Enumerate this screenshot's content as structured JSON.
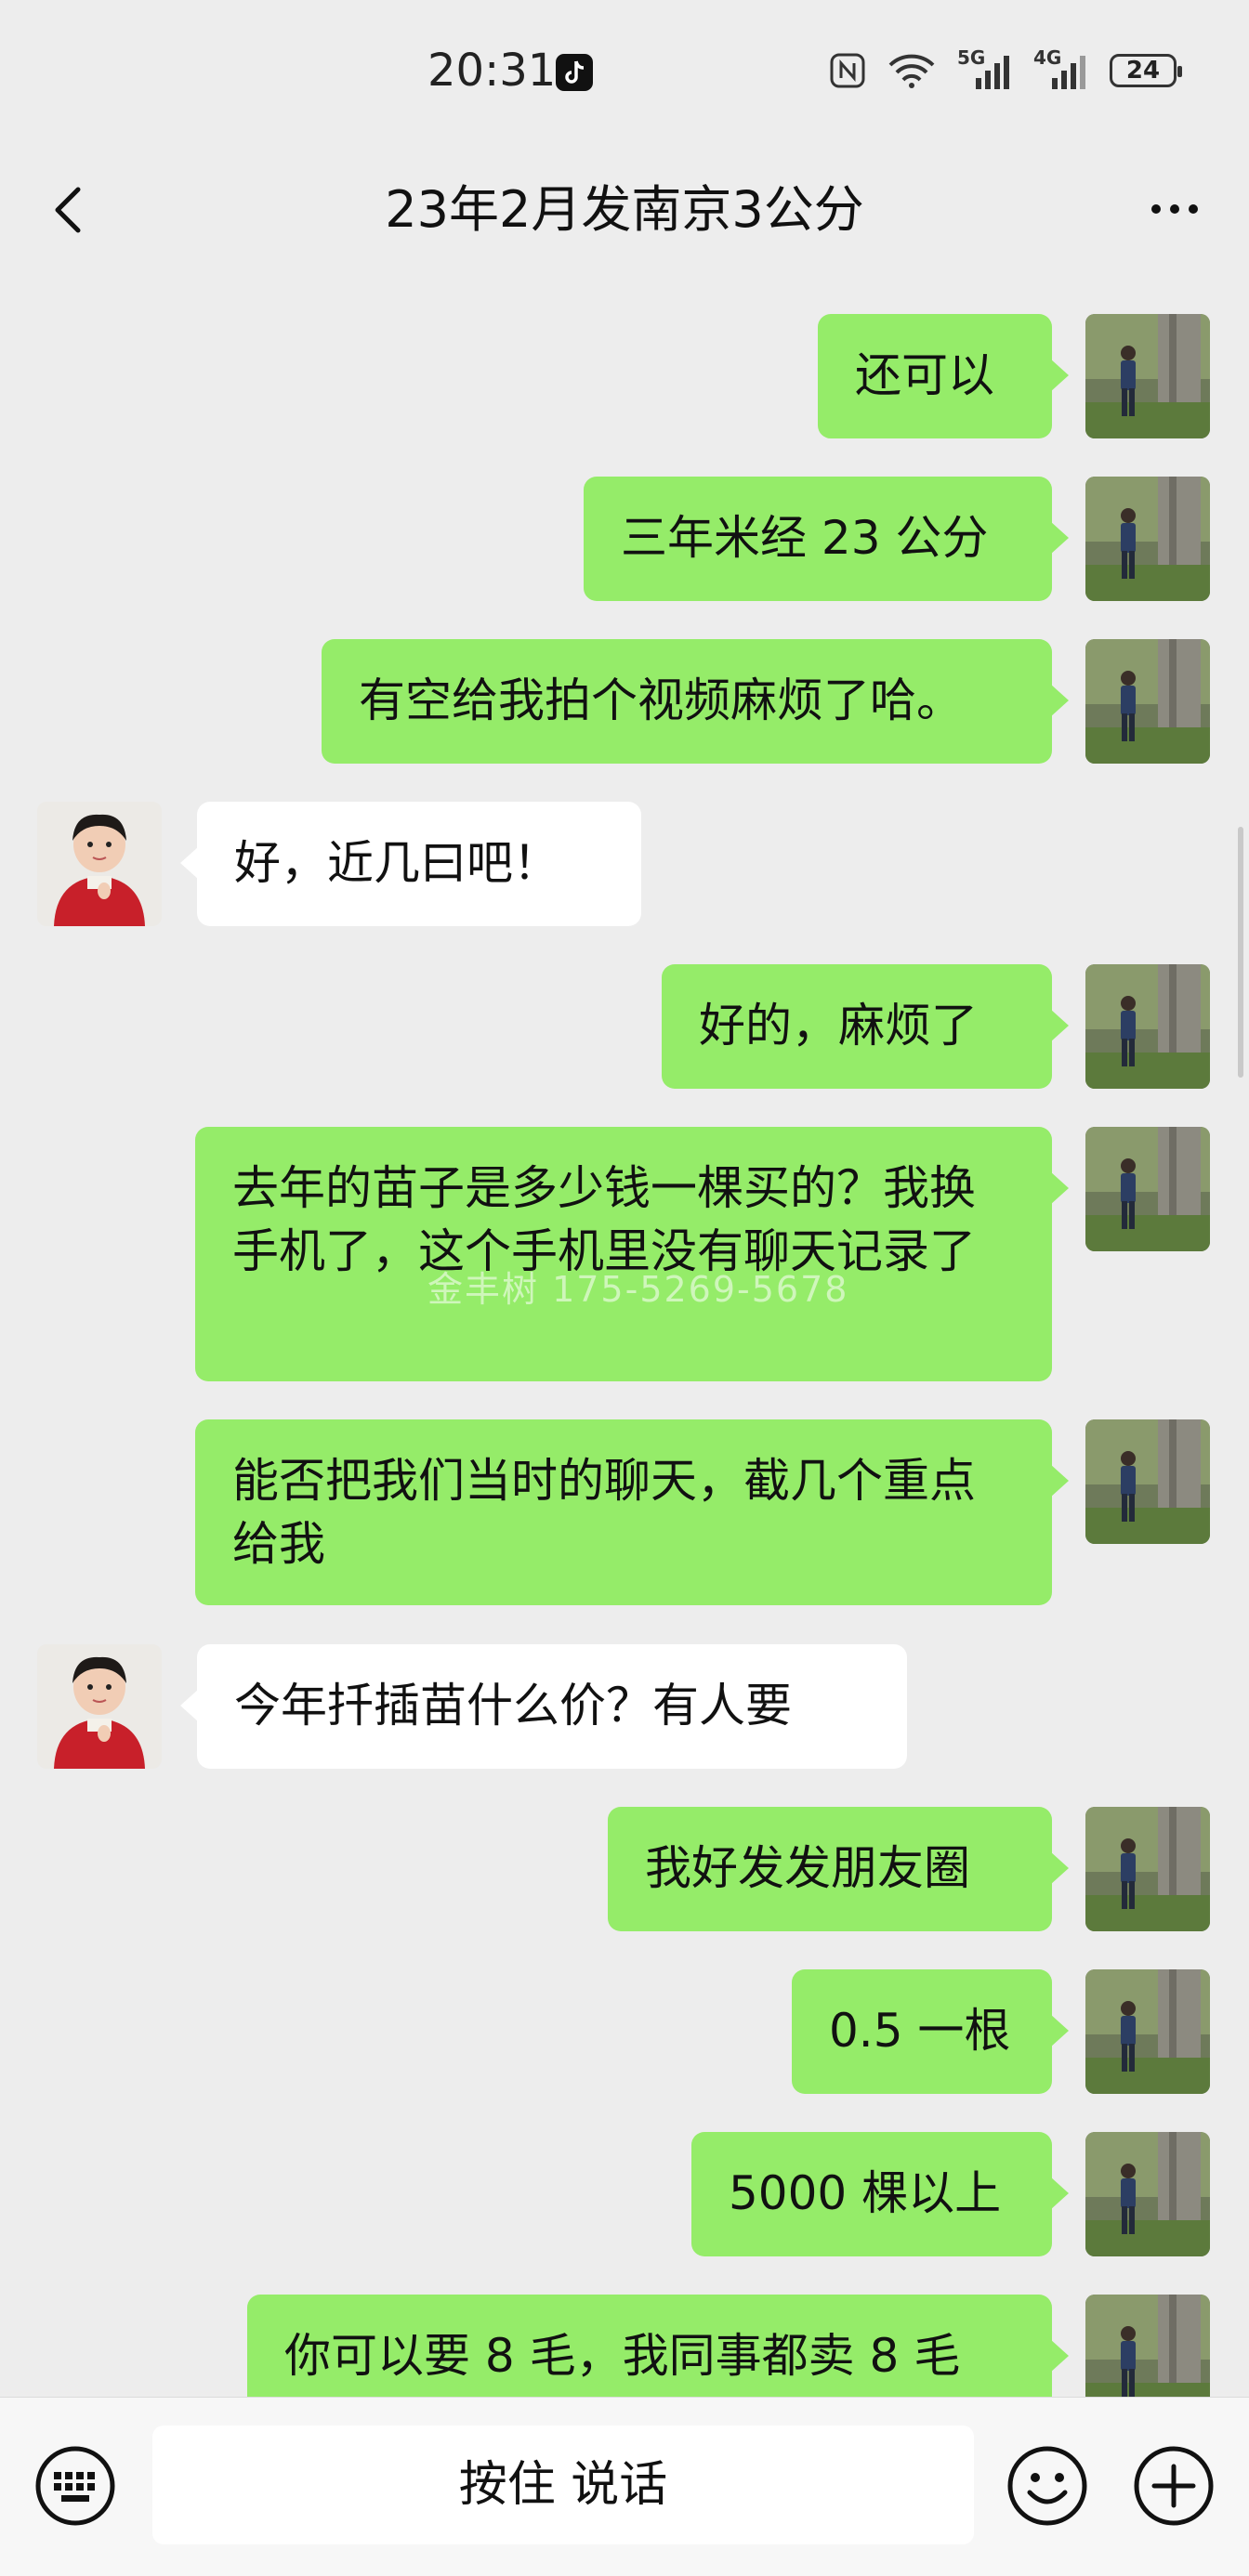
{
  "status_bar": {
    "time": "20:31",
    "battery": "24",
    "icons": [
      "tiktok-icon",
      "nfc-icon",
      "wifi-icon",
      "signal-5g-icon",
      "signal-4g-icon",
      "battery-icon"
    ],
    "network_labels": [
      "5G",
      "4G"
    ]
  },
  "header": {
    "title": "23年2月发南京3公分",
    "back_icon": "chevron-left-icon",
    "more_icon": "more-dots-icon"
  },
  "messages": [
    {
      "side": "right",
      "text": "还可以"
    },
    {
      "side": "right",
      "text": "三年米经 23 公分"
    },
    {
      "side": "right",
      "text": "有空给我拍个视频麻烦了哈。"
    },
    {
      "side": "left",
      "text": "好，近几曰吧！"
    },
    {
      "side": "right",
      "text": "好的，麻烦了"
    },
    {
      "side": "right",
      "text": "去年的苗子是多少钱一棵买的？我换手机了，这个手机里没有聊天记录了"
    },
    {
      "side": "right",
      "text": "能否把我们当时的聊天，截几个重点给我"
    },
    {
      "side": "left",
      "text": "今年扦插苗什么价？有人要"
    },
    {
      "side": "right",
      "text": "我好发发朋友圈"
    },
    {
      "side": "right",
      "text": "0.5 一根"
    },
    {
      "side": "right",
      "text": "5000 棵以上"
    },
    {
      "side": "right",
      "text": "你可以要 8 毛，我同事都卖 8 毛"
    }
  ],
  "watermark": "金丰树 175-5269-5678",
  "input_bar": {
    "hold_to_talk": "按住 说话",
    "icons": [
      "keyboard-icon",
      "emoji-icon",
      "plus-icon"
    ]
  },
  "colors": {
    "background": "#ededed",
    "sent_bubble": "#95ec69",
    "received_bubble": "#ffffff"
  }
}
